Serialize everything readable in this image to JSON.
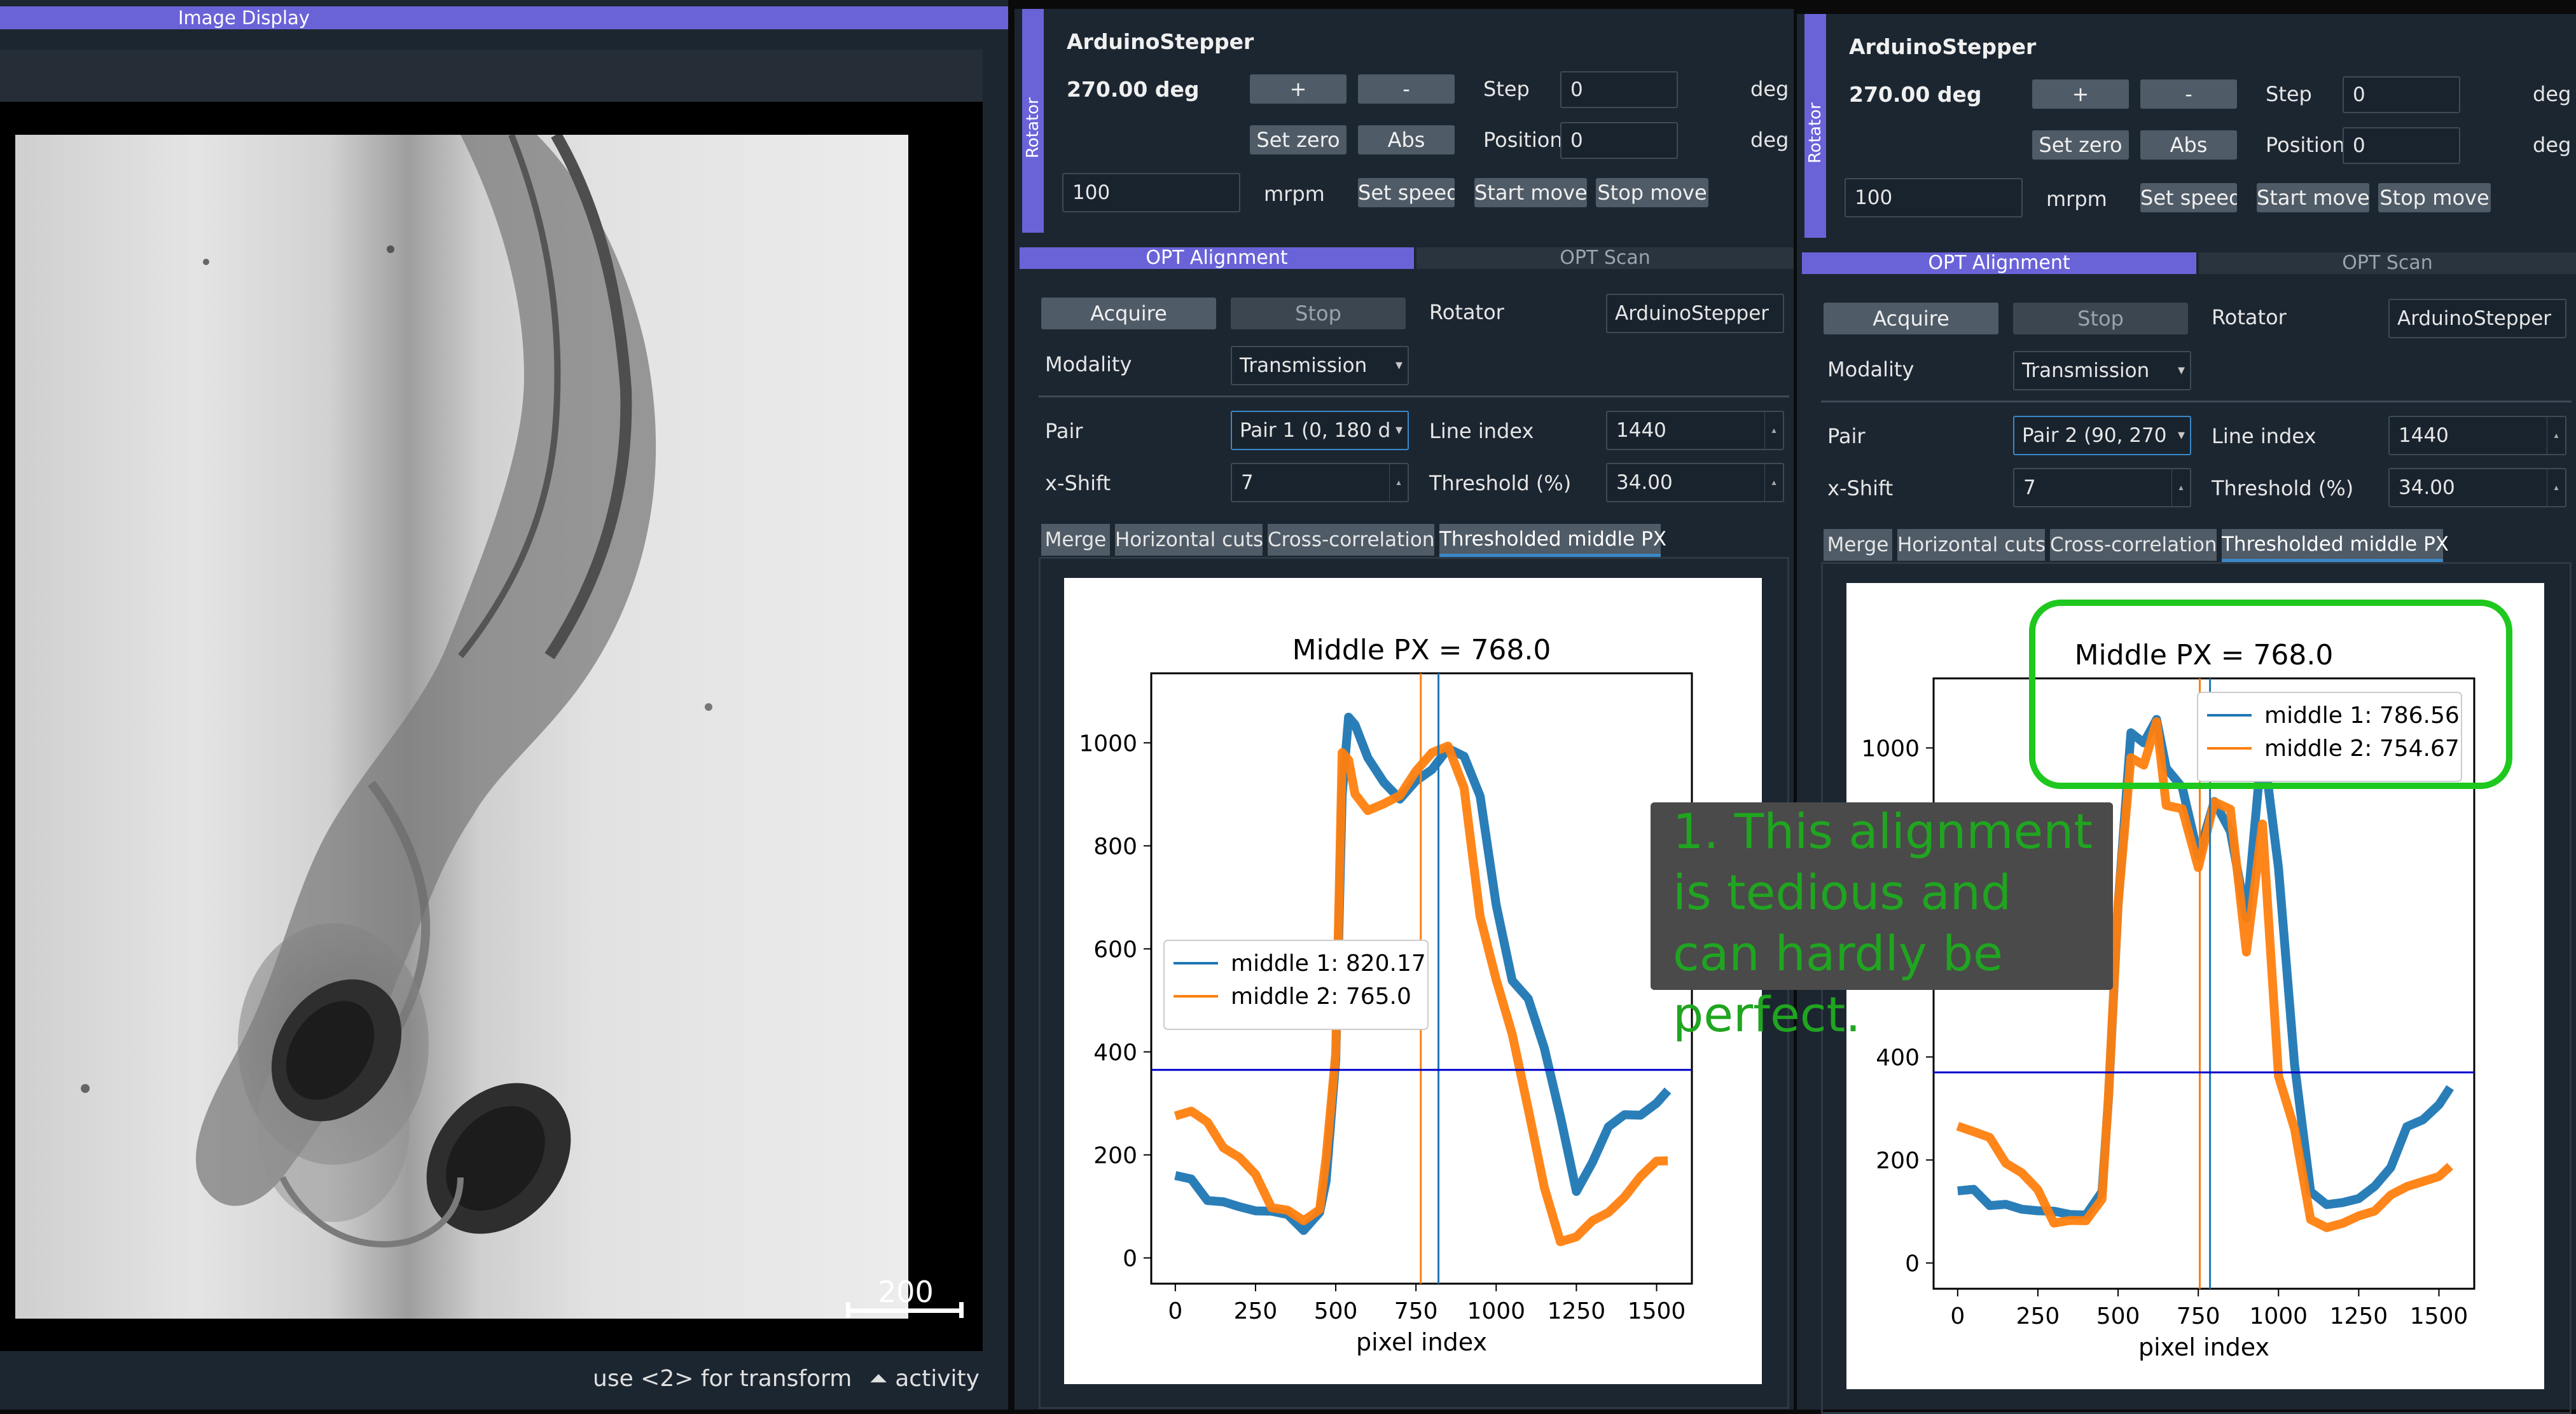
{
  "image_display": {
    "title": "Image Display",
    "scale_bar_label": "200",
    "status_hint": "use <2> for transform",
    "status_activity": "activity"
  },
  "docks": [
    {
      "side_label": "Rotator",
      "rotator": {
        "name": "ArduinoStepper",
        "angle": "270.00 deg",
        "plus": "+",
        "minus": "-",
        "step_label": "Step",
        "step_value": "0",
        "step_unit": "deg",
        "set_zero": "Set zero",
        "abs": "Abs",
        "position_label": "Position",
        "position_value": "0",
        "position_unit": "deg",
        "speed_value": "100",
        "speed_unit": "mrpm",
        "set_speed": "Set speed",
        "start_move": "Start move",
        "stop_move": "Stop move"
      },
      "tabs": [
        "OPT Alignment",
        "OPT Scan"
      ],
      "alignment": {
        "acquire": "Acquire",
        "stop": "Stop",
        "rotator_label": "Rotator",
        "rotator_value": "ArduinoStepper",
        "modality_label": "Modality",
        "modality_value": "Transmission",
        "pair_label": "Pair",
        "pair_value": "Pair 1 (0, 180 d",
        "line_index_label": "Line index",
        "line_index_value": "1440",
        "xshift_label": "x-Shift",
        "xshift_value": "7",
        "threshold_label": "Threshold (%)",
        "threshold_value": "34.00",
        "subtabs": [
          "Merge",
          "Horizontal cuts",
          "Cross-correlation",
          "Thresholded middle PX"
        ]
      },
      "chart_data": {
        "type": "line",
        "title": "Middle PX = 768.0",
        "xlabel": "pixel index",
        "ylabel": "",
        "xlim": [
          -75,
          1610
        ],
        "ylim": [
          -50,
          1135
        ],
        "xticks": [
          0,
          250,
          500,
          750,
          1000,
          1250,
          1500
        ],
        "yticks": [
          0,
          200,
          400,
          600,
          800,
          1000
        ],
        "legend_position": "center-left",
        "threshold": 365,
        "series": [
          {
            "name": "middle 1: 820.17",
            "color": "#1f77b4",
            "vline": 820.17,
            "x": [
              0,
              50,
              100,
              150,
              200,
              250,
              300,
              350,
              400,
              450,
              470,
              500,
              520,
              540,
              560,
              600,
              650,
              700,
              750,
              800,
              850,
              900,
              950,
              1000,
              1050,
              1100,
              1150,
              1200,
              1250,
              1300,
              1350,
              1400,
              1450,
              1500,
              1535
            ],
            "values": [
              160,
              130,
              110,
              95,
              90,
              80,
              75,
              80,
              70,
              100,
              150,
              390,
              920,
              1050,
              1040,
              960,
              900,
              880,
              910,
              940,
              970,
              960,
              880,
              700,
              560,
              520,
              420,
              300,
              150,
              200,
              230,
              260,
              270,
              290,
              320
            ]
          },
          {
            "name": "middle 2: 765.0",
            "color": "#ff7f0e",
            "vline": 765.0,
            "x": [
              0,
              50,
              100,
              150,
              200,
              250,
              300,
              350,
              400,
              450,
              470,
              500,
              520,
              540,
              560,
              600,
              650,
              700,
              750,
              800,
              850,
              900,
              950,
              1000,
              1050,
              1100,
              1150,
              1200,
              1250,
              1300,
              1350,
              1400,
              1450,
              1500,
              1535
            ],
            "values": [
              260,
              270,
              240,
              200,
              180,
              150,
              120,
              100,
              90,
              110,
              200,
              420,
              1000,
              950,
              880,
              860,
              860,
              880,
              930,
              960,
              990,
              920,
              680,
              560,
              450,
              300,
              150,
              50,
              40,
              60,
              80,
              110,
              150,
              170,
              180
            ]
          }
        ]
      }
    },
    {
      "side_label": "Rotator",
      "rotator": {
        "name": "ArduinoStepper",
        "angle": "270.00 deg",
        "plus": "+",
        "minus": "-",
        "step_label": "Step",
        "step_value": "0",
        "step_unit": "deg",
        "set_zero": "Set zero",
        "abs": "Abs",
        "position_label": "Position",
        "position_value": "0",
        "position_unit": "deg",
        "speed_value": "100",
        "speed_unit": "mrpm",
        "set_speed": "Set speed",
        "start_move": "Start move",
        "stop_move": "Stop move"
      },
      "tabs": [
        "OPT Alignment",
        "OPT Scan"
      ],
      "alignment": {
        "acquire": "Acquire",
        "stop": "Stop",
        "rotator_label": "Rotator",
        "rotator_value": "ArduinoStepper",
        "modality_label": "Modality",
        "modality_value": "Transmission",
        "pair_label": "Pair",
        "pair_value": "Pair 2 (90, 270",
        "line_index_label": "Line index",
        "line_index_value": "1440",
        "xshift_label": "x-Shift",
        "xshift_value": "7",
        "threshold_label": "Threshold (%)",
        "threshold_value": "34.00",
        "subtabs": [
          "Merge",
          "Horizontal cuts",
          "Cross-correlation",
          "Thresholded middle PX"
        ]
      },
      "chart_data": {
        "type": "line",
        "title": "Middle PX = 768.0",
        "xlabel": "pixel index",
        "ylabel": "",
        "xlim": [
          -75,
          1610
        ],
        "ylim": [
          -50,
          1135
        ],
        "xticks": [
          0,
          250,
          500,
          750,
          1000,
          1250,
          1500
        ],
        "yticks": [
          0,
          200,
          400,
          600,
          800,
          1000
        ],
        "legend_position": "upper-right",
        "threshold": 370,
        "series": [
          {
            "name": "middle 1: 786.56",
            "color": "#1f77b4",
            "vline": 786.56,
            "x": [
              0,
              50,
              100,
              150,
              200,
              250,
              300,
              350,
              400,
              450,
              470,
              500,
              540,
              580,
              620,
              650,
              700,
              750,
              800,
              850,
              900,
              950,
              1000,
              1050,
              1100,
              1150,
              1200,
              1250,
              1300,
              1350,
              1400,
              1450,
              1500,
              1535
            ],
            "values": [
              140,
              120,
              110,
              100,
              95,
              90,
              85,
              90,
              110,
              150,
              320,
              700,
              1050,
              1010,
              1060,
              950,
              900,
              780,
              880,
              830,
              650,
              1000,
              750,
              400,
              160,
              130,
              130,
              150,
              170,
              200,
              240,
              260,
              300,
              330
            ]
          },
          {
            "name": "middle 2: 754.67",
            "color": "#ff7f0e",
            "vline": 754.67,
            "x": [
              0,
              50,
              100,
              150,
              200,
              250,
              300,
              350,
              400,
              450,
              470,
              500,
              540,
              580,
              620,
              650,
              700,
              750,
              800,
              850,
              900,
              950,
              1000,
              1050,
              1100,
              1150,
              1200,
              1250,
              1300,
              1350,
              1400,
              1450,
              1500,
              1535
            ],
            "values": [
              250,
              240,
              220,
              180,
              160,
              130,
              100,
              90,
              100,
              140,
              330,
              720,
              1000,
              950,
              1030,
              880,
              860,
              750,
              880,
              860,
              600,
              860,
              380,
              280,
              100,
              80,
              90,
              110,
              100,
              120,
              140,
              150,
              160,
              170
            ]
          }
        ]
      }
    }
  ],
  "annotation": {
    "text": "1. This alignment is tedious and can hardly be perfect.",
    "highlight_color": "#1ec81e"
  }
}
